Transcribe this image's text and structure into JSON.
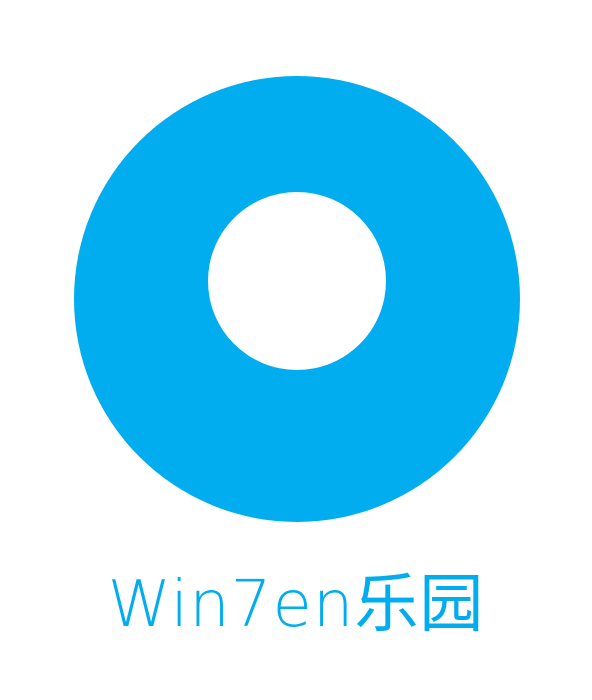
{
  "logo": {
    "brand_name": "Win7en乐园",
    "color": "#01adef",
    "icon": "ring-logo-icon"
  }
}
